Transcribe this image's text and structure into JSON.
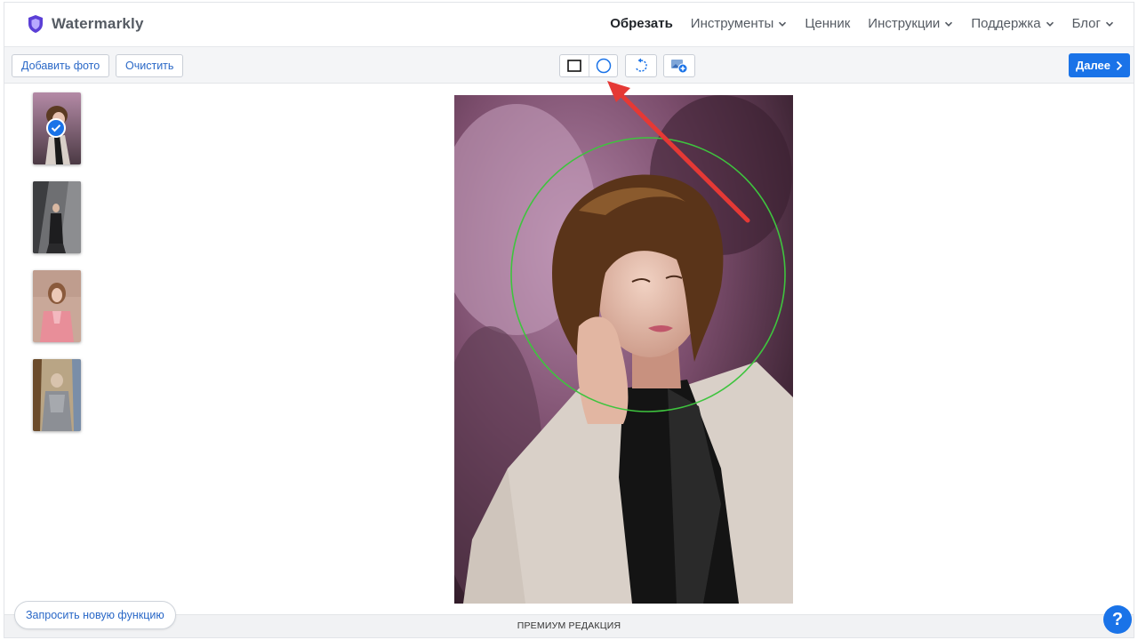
{
  "brand": {
    "name": "Watermarkly",
    "logo_icon": "shield-icon",
    "logo_color": "#5b3fd6"
  },
  "nav": {
    "items": [
      {
        "label": "Обрезать",
        "active": true,
        "dropdown": false
      },
      {
        "label": "Инструменты",
        "active": false,
        "dropdown": true
      },
      {
        "label": "Ценник",
        "active": false,
        "dropdown": false
      },
      {
        "label": "Инструкции",
        "active": false,
        "dropdown": true
      },
      {
        "label": "Поддержка",
        "active": false,
        "dropdown": true
      },
      {
        "label": "Блог",
        "active": false,
        "dropdown": true
      }
    ]
  },
  "toolbar": {
    "add_photo_label": "Добавить фото",
    "clear_label": "Очистить",
    "shape_tools": [
      {
        "icon": "rectangle-crop-icon",
        "selected": false
      },
      {
        "icon": "circle-crop-icon",
        "selected": true
      }
    ],
    "rotate_icon": "rotate-icon",
    "add_image_icon": "add-image-icon",
    "next_label": "Далее",
    "accent_color": "#1a73e8"
  },
  "thumbnails": [
    {
      "name": "photo-1",
      "selected": true
    },
    {
      "name": "photo-2",
      "selected": false
    },
    {
      "name": "photo-3",
      "selected": false
    },
    {
      "name": "photo-4",
      "selected": false
    }
  ],
  "editor": {
    "crop_shape": "circle",
    "crop_outline_color": "#3ec43e",
    "annotation_arrow_color": "#e53935"
  },
  "footer": {
    "premium_label": "ПРЕМИУМ РЕДАКЦИЯ",
    "request_feature_label": "Запросить новую функцию",
    "help_label": "?"
  }
}
